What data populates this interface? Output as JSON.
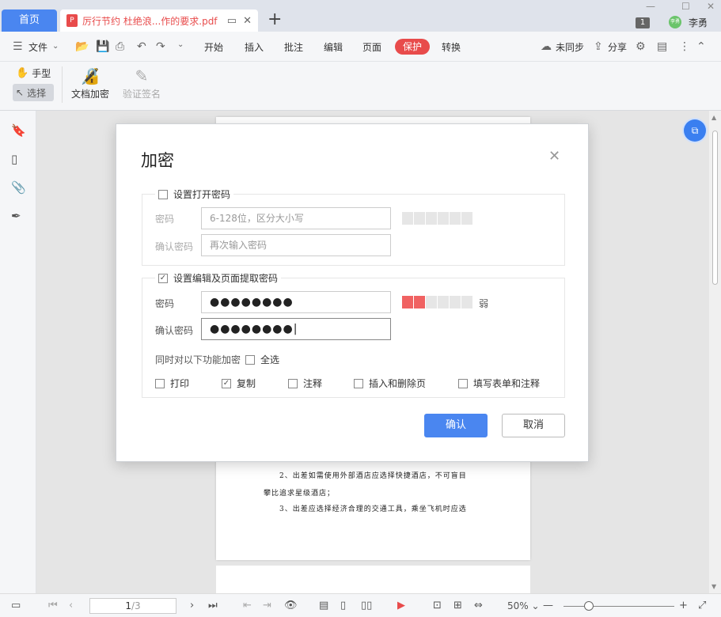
{
  "tabs": {
    "home": "首页",
    "doc_title": "厉行节约 杜绝浪...作的要求.pdf",
    "new_tab": "+",
    "badge": "1",
    "user_initial": "李勇",
    "user_name": "李勇"
  },
  "menu": {
    "file": "文件",
    "items": [
      "开始",
      "插入",
      "批注",
      "编辑",
      "页面",
      "保护",
      "转换"
    ],
    "sync": "未同步",
    "share": "分享"
  },
  "ribbon": {
    "hand": "手型",
    "select": "选择",
    "encrypt": "文档加密",
    "verify_sign": "验证签名"
  },
  "document": {
    "lines": [
      "2、出差如需使用外部酒店应选择快捷酒店，不可盲目",
      "攀比追求星级酒店；",
      "3、出差应选择经济合理的交通工具，乘坐飞机时应选"
    ]
  },
  "dialog": {
    "title": "加密",
    "open_pw": {
      "heading": "设置打开密码",
      "checked": false,
      "pw_label": "密码",
      "pw_placeholder": "6-128位，区分大小写",
      "confirm_label": "确认密码",
      "confirm_placeholder": "再次输入密码"
    },
    "edit_pw": {
      "heading": "设置编辑及页面提取密码",
      "checked": true,
      "pw_label": "密码",
      "pw_value": "●●●●●●●●",
      "confirm_label": "确认密码",
      "confirm_value": "●●●●●●●●",
      "strength_label": "弱",
      "strength_level": 2,
      "strength_max": 6,
      "features_label": "同时对以下功能加密",
      "select_all": "全选",
      "options": [
        {
          "label": "打印",
          "checked": false
        },
        {
          "label": "复制",
          "checked": true
        },
        {
          "label": "注释",
          "checked": false
        },
        {
          "label": "插入和删除页",
          "checked": false
        },
        {
          "label": "填写表单和注释",
          "checked": false
        }
      ]
    },
    "ok": "确认",
    "cancel": "取消"
  },
  "status": {
    "page": "1",
    "total": "/3",
    "zoom": "50%"
  },
  "colors": {
    "accent": "#4a86f0",
    "protect": "#e84b4b",
    "strength_on": "#f06262"
  }
}
